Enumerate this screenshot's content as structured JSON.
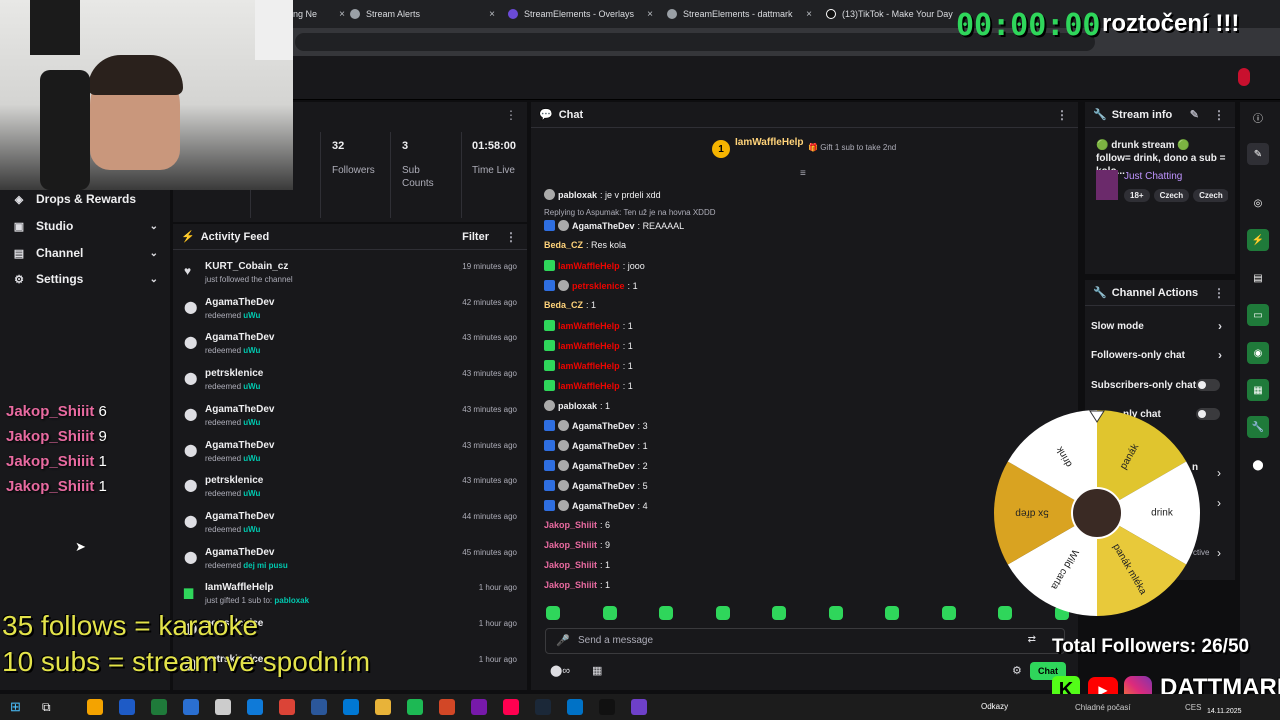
{
  "browser": {
    "tabs": [
      {
        "label": "ng Ne",
        "close": "×"
      },
      {
        "label": "Stream Alerts",
        "close": "×"
      },
      {
        "label": "StreamElements - Overlays",
        "close": "×"
      },
      {
        "label": "StreamElements - dattmark",
        "close": "×"
      },
      {
        "label": "(13)TikTok - Make Your Day",
        "close": "×"
      }
    ]
  },
  "overlay": {
    "timer": "00:00:00",
    "spin_title": "roztočení !!!",
    "goals": [
      "35 follows = karaoke",
      "10 subs = stream ve spodním"
    ],
    "total_followers": "Total Followers: 26/50",
    "brand": "DATTMARK",
    "wheel_segments": [
      "panák",
      "drink",
      "panák mléka",
      "Wild carta",
      "5x dřep",
      "drink"
    ]
  },
  "sidebar": {
    "items": [
      {
        "label": "Drops & Rewards",
        "icon": "drops-icon",
        "glyph": "◈"
      },
      {
        "label": "Studio",
        "icon": "studio-icon",
        "glyph": "▣",
        "chevron": "⌄"
      },
      {
        "label": "Channel",
        "icon": "channel-icon",
        "glyph": "▤",
        "chevron": "⌄"
      },
      {
        "label": "Settings",
        "icon": "gear-icon",
        "glyph": "⚙",
        "chevron": "⌄"
      }
    ],
    "chat_overlay": [
      {
        "user": "Jakop_Shiiit",
        "msg": "6"
      },
      {
        "user": "Jakop_Shiiit",
        "msg": "9"
      },
      {
        "user": "Jakop_Shiiit",
        "msg": "1"
      },
      {
        "user": "Jakop_Shiiit",
        "msg": "1"
      }
    ]
  },
  "stats": [
    {
      "value": "32",
      "label": "Followers"
    },
    {
      "value": "3",
      "label": "Sub Counts"
    },
    {
      "value": "01:58:00",
      "label": "Time Live"
    }
  ],
  "stats_partial_label": "s",
  "activity": {
    "title": "Activity Feed",
    "filter": "Filter",
    "items": [
      {
        "name": "KURT_Cobain_cz",
        "desc": "just followed the channel",
        "reward": "",
        "time": "19 minutes ago",
        "icon": "heart-icon",
        "glyph": "♥"
      },
      {
        "name": "AgamaTheDev",
        "desc": "redeemed",
        "reward": "uWu",
        "time": "42 minutes ago",
        "icon": "points-icon",
        "glyph": "⬤"
      },
      {
        "name": "AgamaTheDev",
        "desc": "redeemed",
        "reward": "uWu",
        "time": "43 minutes ago",
        "icon": "points-icon",
        "glyph": "⬤"
      },
      {
        "name": "petrsklenice",
        "desc": "redeemed",
        "reward": "uWu",
        "time": "43 minutes ago",
        "icon": "points-icon",
        "glyph": "⬤"
      },
      {
        "name": "AgamaTheDev",
        "desc": "redeemed",
        "reward": "uWu",
        "time": "43 minutes ago",
        "icon": "points-icon",
        "glyph": "⬤"
      },
      {
        "name": "AgamaTheDev",
        "desc": "redeemed",
        "reward": "uWu",
        "time": "43 minutes ago",
        "icon": "points-icon",
        "glyph": "⬤"
      },
      {
        "name": "petrsklenice",
        "desc": "redeemed",
        "reward": "uWu",
        "time": "43 minutes ago",
        "icon": "points-icon",
        "glyph": "⬤"
      },
      {
        "name": "AgamaTheDev",
        "desc": "redeemed",
        "reward": "uWu",
        "time": "44 minutes ago",
        "icon": "points-icon",
        "glyph": "⬤"
      },
      {
        "name": "AgamaTheDev",
        "desc": "redeemed",
        "reward": "dej mi pusu",
        "time": "45 minutes ago",
        "icon": "points-icon",
        "glyph": "⬤"
      },
      {
        "name": "IamWaffleHelp",
        "desc": "just gifted 1 sub to:",
        "reward": "pabloxak",
        "time": "1 hour ago",
        "icon": "gift-icon",
        "glyph": "▆"
      },
      {
        "name": "petrsklenice",
        "desc": "",
        "reward": "",
        "time": "1 hour ago",
        "icon": "points-icon",
        "glyph": "⬤"
      },
      {
        "name": "petrsklenice",
        "desc": "",
        "reward": "",
        "time": "1 hour ago",
        "icon": "points-icon",
        "glyph": "⬤"
      }
    ]
  },
  "chat": {
    "title": "Chat",
    "pinned_user": "IamWaffleHelp",
    "pinned_rank": "1",
    "gift_text": "Gift 1 sub to take 2nd",
    "placeholder": "Send a message",
    "send_label": "Chat",
    "messages": [
      {
        "user": "pabloxak",
        "text": "je v prdeli xdd",
        "color": "#efeff1",
        "badges": [
          "b2"
        ]
      },
      {
        "user": "",
        "text": "Replying to Aspumak: Ten už je na hovna XDDD",
        "color": "#adadb8",
        "badges": [],
        "reply": true
      },
      {
        "user": "AgamaTheDev",
        "text": "REAAAAL",
        "color": "#efeff1",
        "badges": [
          "b1",
          "b2"
        ]
      },
      {
        "user": "Beda_CZ",
        "text": "Res kola",
        "color": "#ffd37a",
        "badges": []
      },
      {
        "user": "IamWaffleHelp",
        "text": "jooo",
        "color": "#eb0400",
        "badges": [
          "b3"
        ]
      },
      {
        "user": "petrsklenice",
        "text": "1",
        "color": "#eb0400",
        "badges": [
          "b1",
          "b2"
        ]
      },
      {
        "user": "Beda_CZ",
        "text": "1",
        "color": "#ffd37a",
        "badges": []
      },
      {
        "user": "IamWaffleHelp",
        "text": "1",
        "color": "#eb0400",
        "badges": [
          "b3"
        ]
      },
      {
        "user": "IamWaffleHelp",
        "text": "1",
        "color": "#eb0400",
        "badges": [
          "b3"
        ]
      },
      {
        "user": "IamWaffleHelp",
        "text": "1",
        "color": "#eb0400",
        "badges": [
          "b3"
        ]
      },
      {
        "user": "IamWaffleHelp",
        "text": "1",
        "color": "#eb0400",
        "badges": [
          "b3"
        ]
      },
      {
        "user": "pabloxak",
        "text": "1",
        "color": "#efeff1",
        "badges": [
          "b2"
        ]
      },
      {
        "user": "AgamaTheDev",
        "text": "3",
        "color": "#efeff1",
        "badges": [
          "b1",
          "b2"
        ]
      },
      {
        "user": "AgamaTheDev",
        "text": "1",
        "color": "#efeff1",
        "badges": [
          "b1",
          "b2"
        ]
      },
      {
        "user": "AgamaTheDev",
        "text": "2",
        "color": "#efeff1",
        "badges": [
          "b1",
          "b2"
        ]
      },
      {
        "user": "AgamaTheDev",
        "text": "5",
        "color": "#efeff1",
        "badges": [
          "b1",
          "b2"
        ]
      },
      {
        "user": "AgamaTheDev",
        "text": "4",
        "color": "#efeff1",
        "badges": [
          "b1",
          "b2"
        ]
      },
      {
        "user": "Jakop_Shiiit",
        "text": "6",
        "color": "#e86aa0",
        "badges": []
      },
      {
        "user": "Jakop_Shiiit",
        "text": "9",
        "color": "#e86aa0",
        "badges": []
      },
      {
        "user": "Jakop_Shiiit",
        "text": "1",
        "color": "#e86aa0",
        "badges": []
      },
      {
        "user": "Jakop_Shiiit",
        "text": "1",
        "color": "#e86aa0",
        "badges": []
      }
    ]
  },
  "stream_info": {
    "title": "Stream info",
    "text": "🟢 drunk stream 🟢 follow= drink, dono a sub = kolo...",
    "category": "Just Chatting",
    "tags": [
      "18+",
      "Czech",
      "Czech"
    ]
  },
  "channel_actions": {
    "title": "Channel Actions",
    "items": [
      {
        "label": "Slow mode",
        "type": "arrow",
        "arrow": "›"
      },
      {
        "label": "Followers-only chat",
        "type": "arrow",
        "arrow": "›"
      },
      {
        "label": "Subscribers-only chat",
        "type": "toggle"
      },
      {
        "label": "nly chat",
        "type": "toggle"
      }
    ],
    "partial_labels": [
      "n",
      "ctive"
    ],
    "partial_arrow": "›"
  },
  "taskbar": {
    "links_label": "Odkazy",
    "weather": "Chladné počasí",
    "date": "14.11.2025",
    "lang": "CES"
  },
  "colors": {
    "accent": "#9147ff",
    "green": "#2fd65b",
    "red": "#eb0400"
  }
}
